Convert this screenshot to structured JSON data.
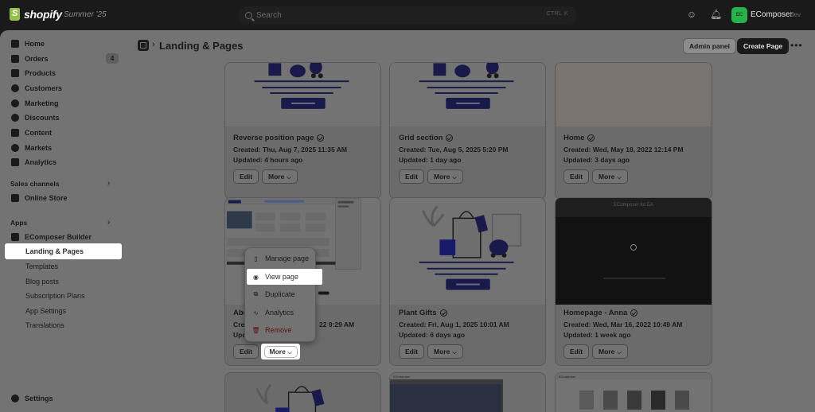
{
  "topbar": {
    "brand": "shopify",
    "edition": "Summer '25",
    "search_placeholder": "Search",
    "shortcut": "CTRL  K",
    "store_badge": "EC",
    "store_name": "EComposer",
    "store_suffix": "dev"
  },
  "sidebar": {
    "items": [
      {
        "label": "Home",
        "icon": "home-icon"
      },
      {
        "label": "Orders",
        "icon": "orders-icon",
        "badge": "4"
      },
      {
        "label": "Products",
        "icon": "products-icon"
      },
      {
        "label": "Customers",
        "icon": "customers-icon"
      },
      {
        "label": "Marketing",
        "icon": "marketing-icon"
      },
      {
        "label": "Discounts",
        "icon": "discounts-icon"
      },
      {
        "label": "Content",
        "icon": "content-icon"
      },
      {
        "label": "Markets",
        "icon": "markets-icon"
      },
      {
        "label": "Analytics",
        "icon": "analytics-icon"
      }
    ],
    "sales_channels_label": "Sales channels",
    "online_store": "Online Store",
    "apps_label": "Apps",
    "app_name": "EComposer Builder",
    "app_sub": [
      "Landing & Pages",
      "Templates",
      "Blog posts",
      "Subscription Plans",
      "App Settings",
      "Translations"
    ],
    "settings": "Settings"
  },
  "header": {
    "title": "Landing & Pages",
    "admin_panel": "Admin panel",
    "create_page": "Create Page"
  },
  "cards": [
    {
      "title": "Reverse position page",
      "created": "Created: Thu, Aug 7, 2025 11:35 AM",
      "updated": "Updated: 4 hours ago"
    },
    {
      "title": "Grid section",
      "created": "Created: Tue, Aug 5, 2025 5:20 PM",
      "updated": "Updated: 1 day ago"
    },
    {
      "title": "Home",
      "created": "Created: Wed, May 18, 2022 12:14 PM",
      "updated": "Updated: 3 days ago"
    },
    {
      "title": "Abo",
      "created": "Crea",
      "created_tail": "22 9:29 AM",
      "updated": "Upd"
    },
    {
      "title": "Plant Gifts",
      "created": "Created: Fri, Aug 1, 2025 10:01 AM",
      "updated": "Updated: 6 days ago"
    },
    {
      "title": "Homepage - Anna",
      "created": "Created: Wed, Mar 16, 2022 10:49 AM",
      "updated": "Updated: 1 week ago"
    }
  ],
  "buttons": {
    "edit": "Edit",
    "more": "More"
  },
  "popup": {
    "items": [
      {
        "label": "Manage page",
        "icon": "page-icon"
      },
      {
        "label": "View page",
        "icon": "eye-icon"
      },
      {
        "label": "Duplicate",
        "icon": "duplicate-icon"
      },
      {
        "label": "Analytics",
        "icon": "analytics-icon"
      },
      {
        "label": "Remove",
        "icon": "trash-icon"
      }
    ]
  },
  "thumb_text": {
    "brand_small": "EComposer",
    "anna_header": "EComposer for EA"
  }
}
